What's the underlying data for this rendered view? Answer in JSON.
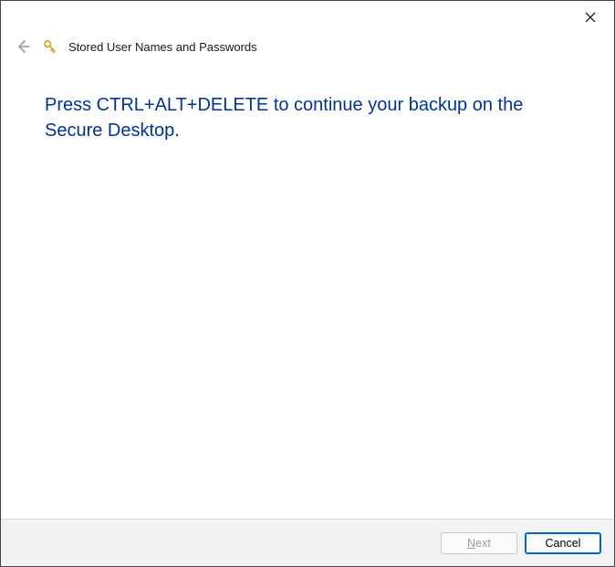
{
  "titlebar": {
    "close_tooltip": "Close"
  },
  "header": {
    "title": "Stored User Names and Passwords"
  },
  "content": {
    "instruction": "Press CTRL+ALT+DELETE to continue your backup on the Secure Desktop."
  },
  "footer": {
    "next_mnemonic": "N",
    "next_rest": "ext",
    "cancel_label": "Cancel"
  },
  "colors": {
    "instruction_color": "#003399",
    "footer_bg": "#f3f3f3",
    "border": "#dcdcdc"
  }
}
